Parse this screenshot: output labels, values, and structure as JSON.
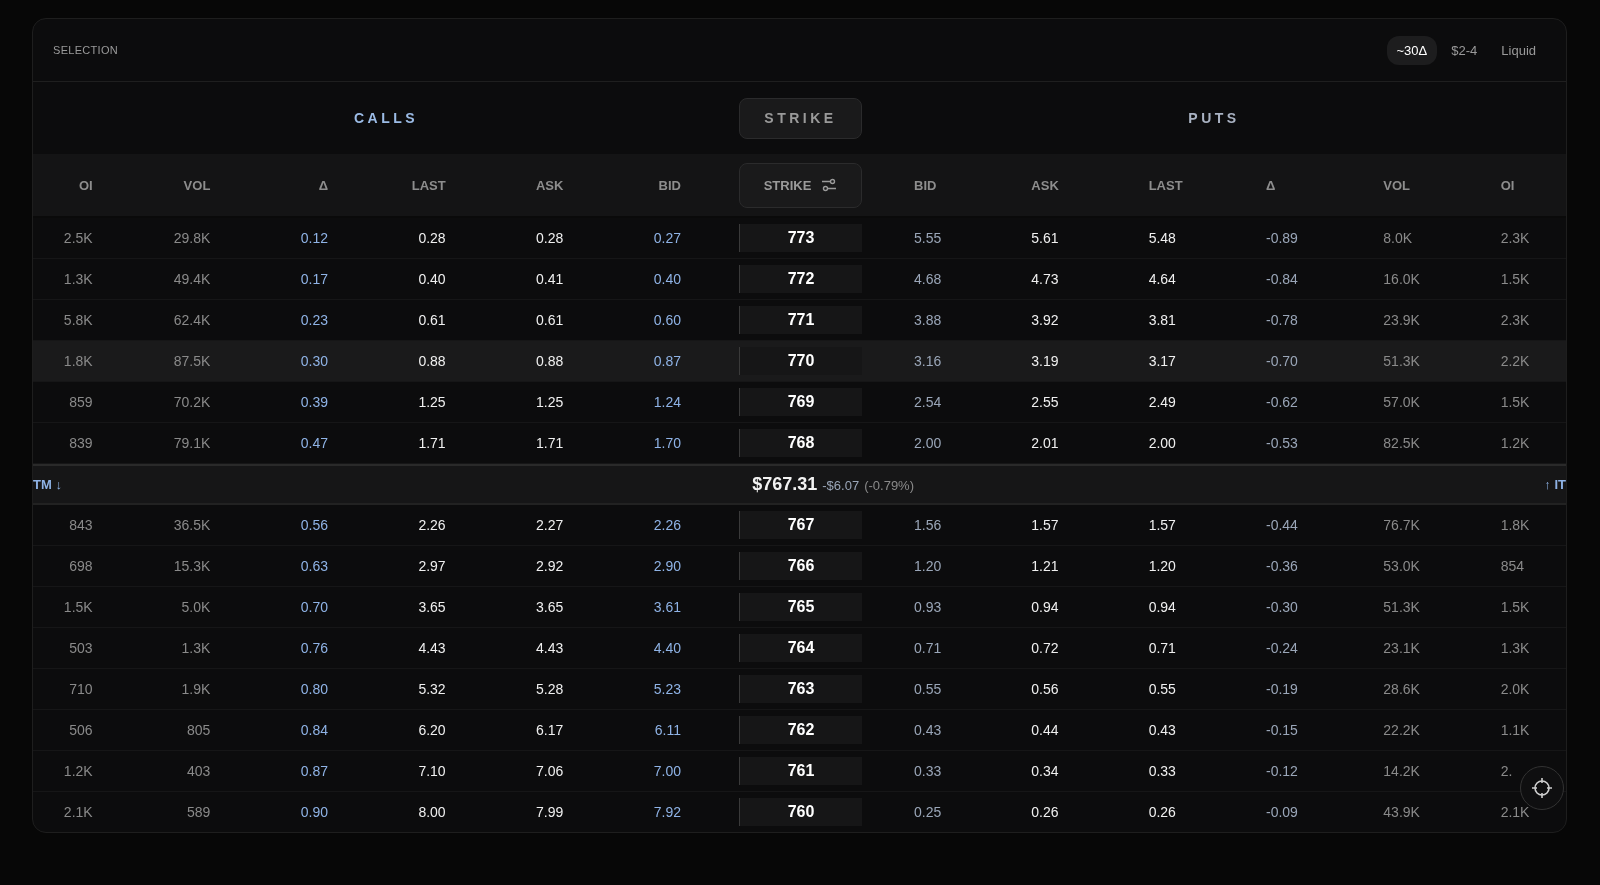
{
  "header": {
    "title": "SELECTION",
    "filters": [
      {
        "label": "~30Δ",
        "selected": true
      },
      {
        "label": "$2-4",
        "selected": false
      },
      {
        "label": "Liquid",
        "selected": false
      }
    ]
  },
  "sections": {
    "calls": "CALLS",
    "strike": "STRIKE",
    "puts": "PUTS"
  },
  "call_columns": [
    {
      "label": "OI"
    },
    {
      "label": "VOL"
    },
    {
      "label": "Δ"
    },
    {
      "label": "LAST"
    },
    {
      "label": "ASK"
    },
    {
      "label": "BID"
    }
  ],
  "strike_column": {
    "label": "STRIKE"
  },
  "put_columns": [
    {
      "label": "BID"
    },
    {
      "label": "ASK"
    },
    {
      "label": "LAST"
    },
    {
      "label": "Δ"
    },
    {
      "label": "VOL"
    },
    {
      "label": "OI"
    }
  ],
  "rows_above": [
    {
      "strike": "773",
      "highlighted": false,
      "calls": [
        "2.5K",
        "29.8K",
        "0.12",
        "0.28",
        "0.28",
        "0.27"
      ],
      "puts": [
        "5.55",
        "5.61",
        "5.48",
        "-0.89",
        "8.0K",
        "2.3K"
      ]
    },
    {
      "strike": "772",
      "highlighted": false,
      "calls": [
        "1.3K",
        "49.4K",
        "0.17",
        "0.40",
        "0.41",
        "0.40"
      ],
      "puts": [
        "4.68",
        "4.73",
        "4.64",
        "-0.84",
        "16.0K",
        "1.5K"
      ]
    },
    {
      "strike": "771",
      "highlighted": false,
      "calls": [
        "5.8K",
        "62.4K",
        "0.23",
        "0.61",
        "0.61",
        "0.60"
      ],
      "puts": [
        "3.88",
        "3.92",
        "3.81",
        "-0.78",
        "23.9K",
        "2.3K"
      ]
    },
    {
      "strike": "770",
      "highlighted": true,
      "calls": [
        "1.8K",
        "87.5K",
        "0.30",
        "0.88",
        "0.88",
        "0.87"
      ],
      "puts": [
        "3.16",
        "3.19",
        "3.17",
        "-0.70",
        "51.3K",
        "2.2K"
      ]
    },
    {
      "strike": "769",
      "highlighted": false,
      "calls": [
        "859",
        "70.2K",
        "0.39",
        "1.25",
        "1.25",
        "1.24"
      ],
      "puts": [
        "2.54",
        "2.55",
        "2.49",
        "-0.62",
        "57.0K",
        "1.5K"
      ]
    },
    {
      "strike": "768",
      "highlighted": false,
      "calls": [
        "839",
        "79.1K",
        "0.47",
        "1.71",
        "1.71",
        "1.70"
      ],
      "puts": [
        "2.00",
        "2.01",
        "2.00",
        "-0.53",
        "82.5K",
        "1.2K"
      ]
    }
  ],
  "price_bar": {
    "left": "TM ↓",
    "price": "$767.31",
    "change": "-$6.07",
    "percent": "(-0.79%)",
    "right": "↑ IT"
  },
  "rows_below": [
    {
      "strike": "767",
      "highlighted": false,
      "calls": [
        "843",
        "36.5K",
        "0.56",
        "2.26",
        "2.27",
        "2.26"
      ],
      "puts": [
        "1.56",
        "1.57",
        "1.57",
        "-0.44",
        "76.7K",
        "1.8K"
      ]
    },
    {
      "strike": "766",
      "highlighted": false,
      "calls": [
        "698",
        "15.3K",
        "0.63",
        "2.97",
        "2.92",
        "2.90"
      ],
      "puts": [
        "1.20",
        "1.21",
        "1.20",
        "-0.36",
        "53.0K",
        "854"
      ]
    },
    {
      "strike": "765",
      "highlighted": false,
      "calls": [
        "1.5K",
        "5.0K",
        "0.70",
        "3.65",
        "3.65",
        "3.61"
      ],
      "puts": [
        "0.93",
        "0.94",
        "0.94",
        "-0.30",
        "51.3K",
        "1.5K"
      ]
    },
    {
      "strike": "764",
      "highlighted": false,
      "calls": [
        "503",
        "1.3K",
        "0.76",
        "4.43",
        "4.43",
        "4.40"
      ],
      "puts": [
        "0.71",
        "0.72",
        "0.71",
        "-0.24",
        "23.1K",
        "1.3K"
      ]
    },
    {
      "strike": "763",
      "highlighted": false,
      "calls": [
        "710",
        "1.9K",
        "0.80",
        "5.32",
        "5.28",
        "5.23"
      ],
      "puts": [
        "0.55",
        "0.56",
        "0.55",
        "-0.19",
        "28.6K",
        "2.0K"
      ]
    },
    {
      "strike": "762",
      "highlighted": false,
      "calls": [
        "506",
        "805",
        "0.84",
        "6.20",
        "6.17",
        "6.11"
      ],
      "puts": [
        "0.43",
        "0.44",
        "0.43",
        "-0.15",
        "22.2K",
        "1.1K"
      ]
    },
    {
      "strike": "761",
      "highlighted": false,
      "calls": [
        "1.2K",
        "403",
        "0.87",
        "7.10",
        "7.06",
        "7.00"
      ],
      "puts": [
        "0.33",
        "0.34",
        "0.33",
        "-0.12",
        "14.2K",
        "2."
      ]
    },
    {
      "strike": "760",
      "highlighted": false,
      "calls": [
        "2.1K",
        "589",
        "0.90",
        "8.00",
        "7.99",
        "7.92"
      ],
      "puts": [
        "0.25",
        "0.26",
        "0.26",
        "-0.09",
        "43.9K",
        "2.1K"
      ]
    }
  ]
}
